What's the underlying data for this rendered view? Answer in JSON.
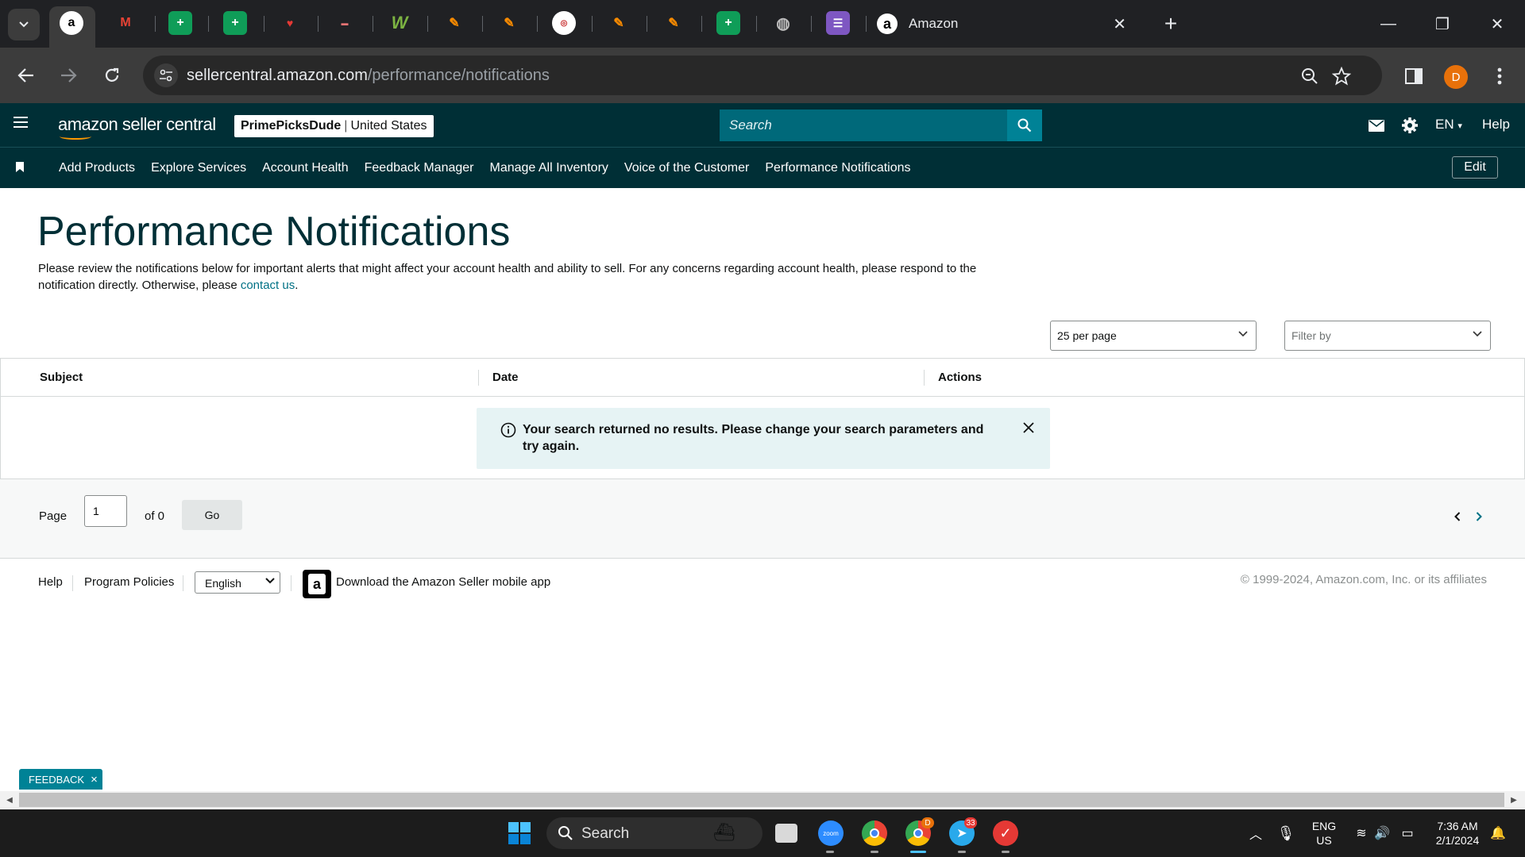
{
  "browser": {
    "active_tab_title": "Amazon",
    "url_host": "sellercentral.amazon.com",
    "url_path": "/performance/notifications",
    "profile_initial": "D"
  },
  "header": {
    "logo_text": "amazon seller central",
    "store_name": "PrimePicksDude",
    "store_region": "United States",
    "search_placeholder": "Search",
    "language": "EN",
    "help": "Help"
  },
  "bookmarks": {
    "items": [
      "Add Products",
      "Explore Services",
      "Account Health",
      "Feedback Manager",
      "Manage All Inventory",
      "Voice of the Customer",
      "Performance Notifications"
    ],
    "edit_label": "Edit"
  },
  "page": {
    "title": "Performance Notifications",
    "intro": "Please review the notifications below for important alerts that might affect your account health and ability to sell. For any concerns regarding account health, please respond to the notification directly. Otherwise, please ",
    "contact_link": "contact us",
    "intro_end": "."
  },
  "filters": {
    "per_page": "25 per page",
    "filter_placeholder": "Filter by"
  },
  "table": {
    "columns": [
      "Subject",
      "Date",
      "Actions"
    ],
    "no_results": "Your search returned no results. Please change your search parameters and try again."
  },
  "pagination": {
    "page_label": "Page",
    "page_value": "1",
    "of_label": "of 0",
    "go_label": "Go"
  },
  "footer": {
    "help": "Help",
    "program_policies": "Program Policies",
    "language": "English",
    "app_link": "Download the Amazon Seller mobile app",
    "copyright": "© 1999-2024, Amazon.com, Inc. or its affiliates"
  },
  "feedback": {
    "label": "FEEDBACK"
  },
  "taskbar": {
    "search": "Search",
    "lang_line1": "ENG",
    "lang_line2": "US",
    "time": "7:36 AM",
    "date": "2/1/2024",
    "telegram_badge": "33",
    "chrome_badge": "D"
  },
  "colors": {
    "header_bg": "#002f36",
    "search_bg": "#00697a",
    "link": "#007185",
    "alert_bg": "#e6f3f4",
    "feedback_bg": "#008296"
  }
}
